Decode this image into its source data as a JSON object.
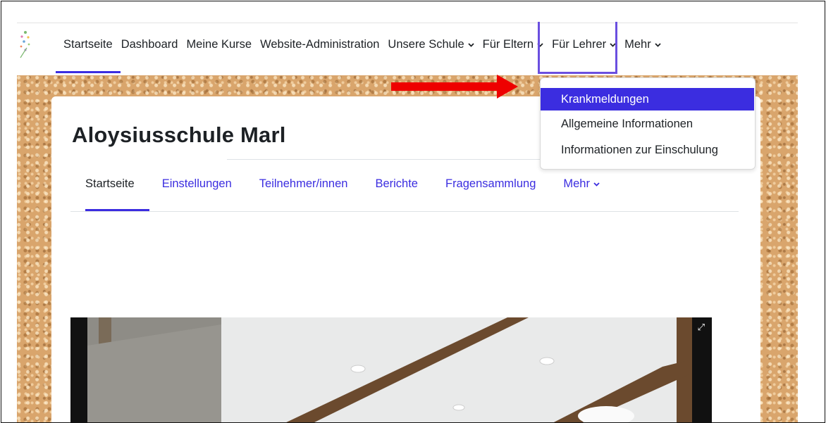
{
  "nav": {
    "items": [
      {
        "label": "Startseite",
        "active": true,
        "dropdown": false
      },
      {
        "label": "Dashboard",
        "active": false,
        "dropdown": false
      },
      {
        "label": "Meine Kurse",
        "active": false,
        "dropdown": false
      },
      {
        "label": "Website-Administration",
        "active": false,
        "dropdown": false
      },
      {
        "label": "Unsere Schule",
        "active": false,
        "dropdown": true
      },
      {
        "label": "Für Eltern",
        "active": false,
        "dropdown": true
      },
      {
        "label": "Für Lehrer",
        "active": false,
        "dropdown": true
      },
      {
        "label": "Mehr",
        "active": false,
        "dropdown": true
      }
    ]
  },
  "dropdown": {
    "items": [
      {
        "label": "Krankmeldungen",
        "highlighted": true
      },
      {
        "label": "Allgemeine Informationen",
        "highlighted": false
      },
      {
        "label": "Informationen zur Einschulung",
        "highlighted": false
      }
    ]
  },
  "page": {
    "title": "Aloysiusschule Marl"
  },
  "secondary_nav": {
    "items": [
      {
        "label": "Startseite",
        "active": true
      },
      {
        "label": "Einstellungen",
        "active": false
      },
      {
        "label": "Teilnehmer/innen",
        "active": false
      },
      {
        "label": "Berichte",
        "active": false
      },
      {
        "label": "Fragensammlung",
        "active": false
      },
      {
        "label": "Mehr",
        "active": false,
        "dropdown": true
      }
    ]
  },
  "colors": {
    "accent": "#3b2de0",
    "highlight_box": "#6a4fe0",
    "arrow": "#ee0000",
    "text": "#1d2125"
  },
  "icons": {
    "caret": "chevron-down-icon",
    "expand": "expand-icon"
  }
}
